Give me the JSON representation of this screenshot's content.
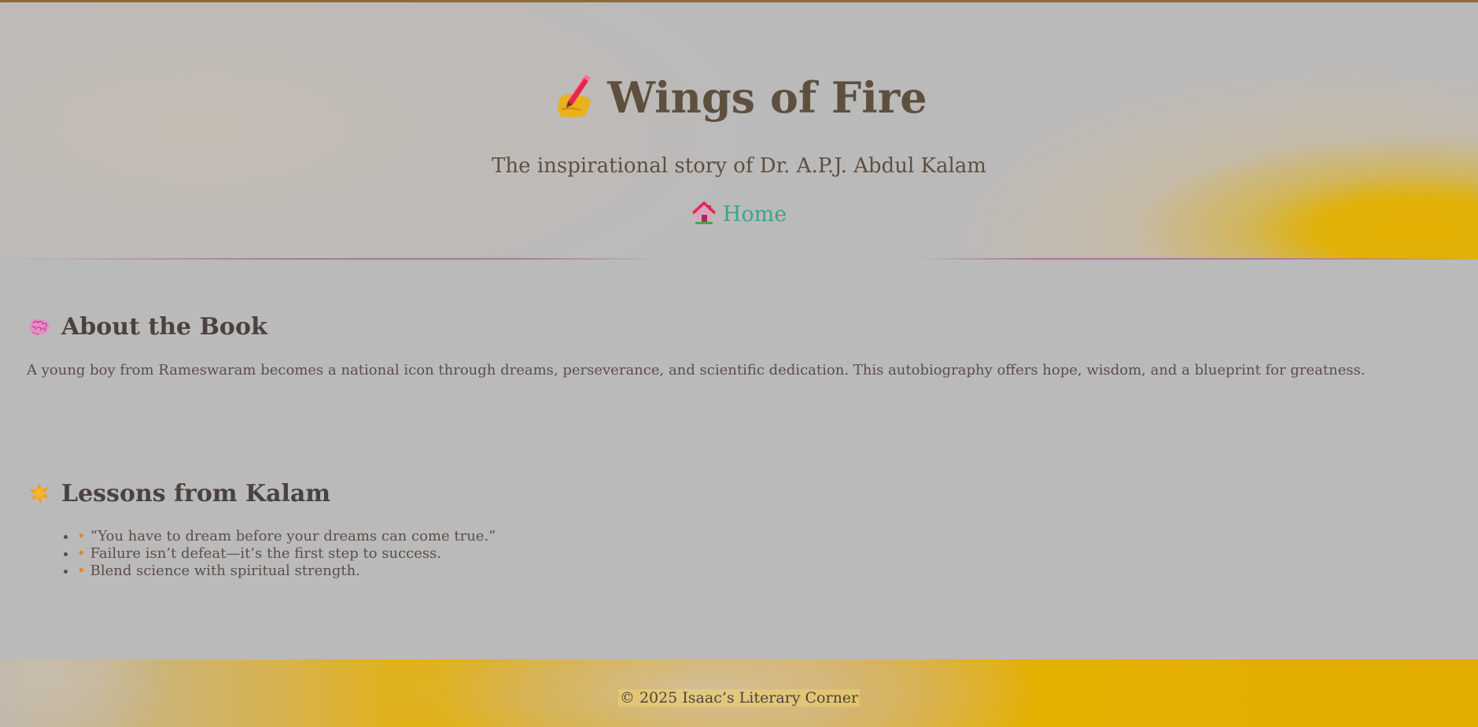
{
  "header": {
    "title": "Wings of Fire",
    "title_icon": "writing-hand-icon",
    "subtitle": "The inspirational story of Dr. A.P.J. Abdul Kalam",
    "nav": {
      "home_label": "Home",
      "home_icon": "house-icon"
    }
  },
  "about": {
    "icon": "brain-icon",
    "heading": "About the Book",
    "text": "A young boy from Rameswaram becomes a national icon through dreams, perseverance, and scientific dedication. This autobiography offers hope, wisdom, and a blueprint for greatness."
  },
  "lessons": {
    "icon": "sparkle-icon",
    "heading": "Lessons from Kalam",
    "items": [
      "“You have to dream before your dreams can come true.”",
      "Failure isn’t defeat—it’s the first step to success.",
      "Blend science with spiritual strength."
    ]
  },
  "footer": {
    "text": "© 2025 Isaac’s Literary Corner"
  },
  "colors": {
    "background": "#bbbaba",
    "title": "#5e4f3e",
    "link": "#3fa38a",
    "accent_yellow": "#e4b000",
    "bullet_orange": "#e0842e"
  }
}
